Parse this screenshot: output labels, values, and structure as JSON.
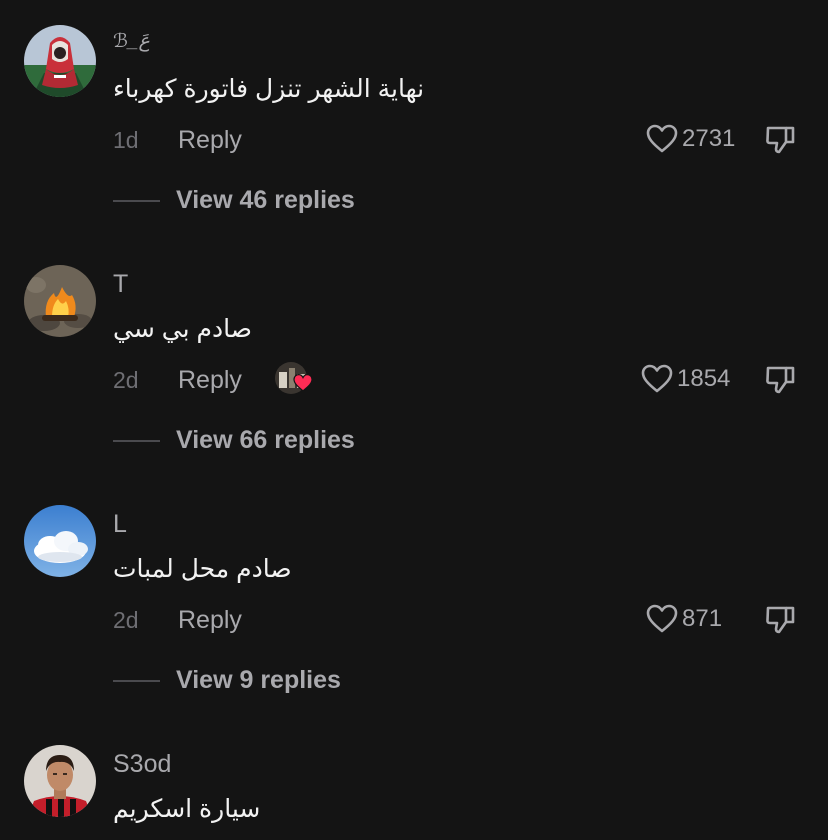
{
  "comments": [
    {
      "username": "ℬ_عَ",
      "text": "نهاية الشهر تنزل فاتورة كهرباء",
      "age": "1d",
      "reply_label": "Reply",
      "likes": "2731",
      "view_replies": "View 46 replies",
      "avatar": "person-with-red-keffiyeh"
    },
    {
      "username": "T",
      "text": "صادم بي سي",
      "age": "2d",
      "reply_label": "Reply",
      "likes": "1854",
      "view_replies": "View 66 replies",
      "avatar": "campfire",
      "liked_by_creator": true
    },
    {
      "username": "L",
      "text": "صادم محل لمبات",
      "age": "2d",
      "reply_label": "Reply",
      "likes": "871",
      "view_replies": "View 9 replies",
      "avatar": "clouds-sky"
    },
    {
      "username": "S3od",
      "text": "سيارة اسكريم",
      "avatar": "footballer-red-black-jersey"
    }
  ],
  "icons": {
    "like": "heart-outline-icon",
    "dislike": "thumbs-down-icon",
    "creator_like": "red-heart-icon"
  },
  "colors": {
    "background": "#141414",
    "secondary_text": "#a9a9ad",
    "timestamp": "#6e6e73",
    "heart_red": "#fe2c55"
  }
}
